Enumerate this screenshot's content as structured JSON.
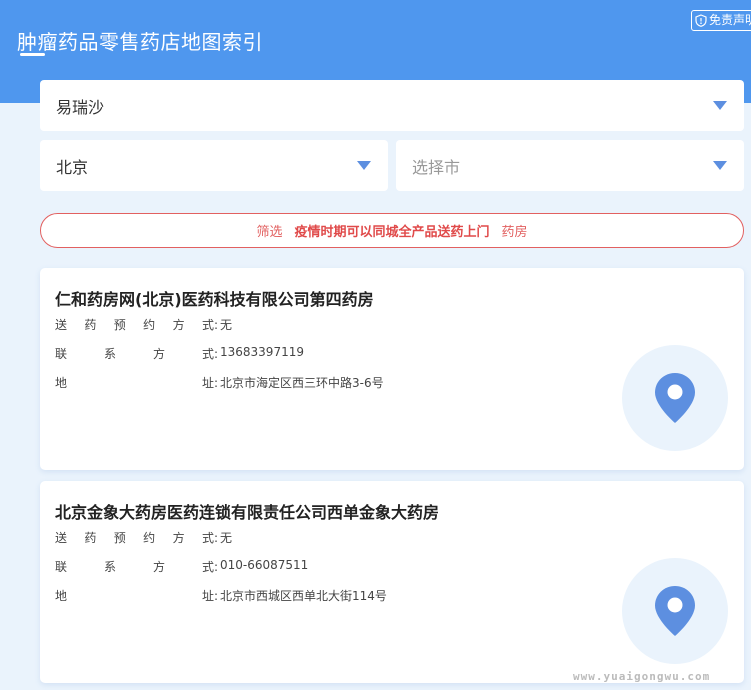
{
  "header": {
    "title": "肿瘤药品零售药店地图索引",
    "disclaimer": "免责声明"
  },
  "filters": {
    "drug": "易瑞沙",
    "province": "北京",
    "city_placeholder": "选择市"
  },
  "banner": {
    "prefix": "筛选",
    "highlight": "疫情时期可以同城全产品送药上门",
    "suffix": "药房"
  },
  "stores": [
    {
      "name": "仁和药房网(北京)医药科技有限公司第四药房",
      "delivery_label": [
        "送",
        "药",
        "预",
        "约",
        "方",
        "式:"
      ],
      "delivery": "无",
      "contact_label": [
        "联",
        "系",
        "方",
        "式:"
      ],
      "contact": "13683397119",
      "address_label": [
        "地",
        "址:"
      ],
      "address": "北京市海定区西三环中路3-6号"
    },
    {
      "name": "北京金象大药房医药连锁有限责任公司西单金象大药房",
      "delivery_label": [
        "送",
        "药",
        "预",
        "约",
        "方",
        "式:"
      ],
      "delivery": "无",
      "contact_label": [
        "联",
        "系",
        "方",
        "式:"
      ],
      "contact": "010-66087511",
      "address_label": [
        "地",
        "址:"
      ],
      "address": "北京市西城区西单北大街114号"
    }
  ],
  "watermark": "www.yuaigongwu.com",
  "colors": {
    "header": "#4f97ee",
    "background": "#eaf3fc",
    "accent_red": "#e26060",
    "pin": "#5d8fe0"
  },
  "icons": {
    "disclaimer": "shield-icon",
    "caret": "caret-down-icon",
    "location": "location-pin-icon"
  }
}
